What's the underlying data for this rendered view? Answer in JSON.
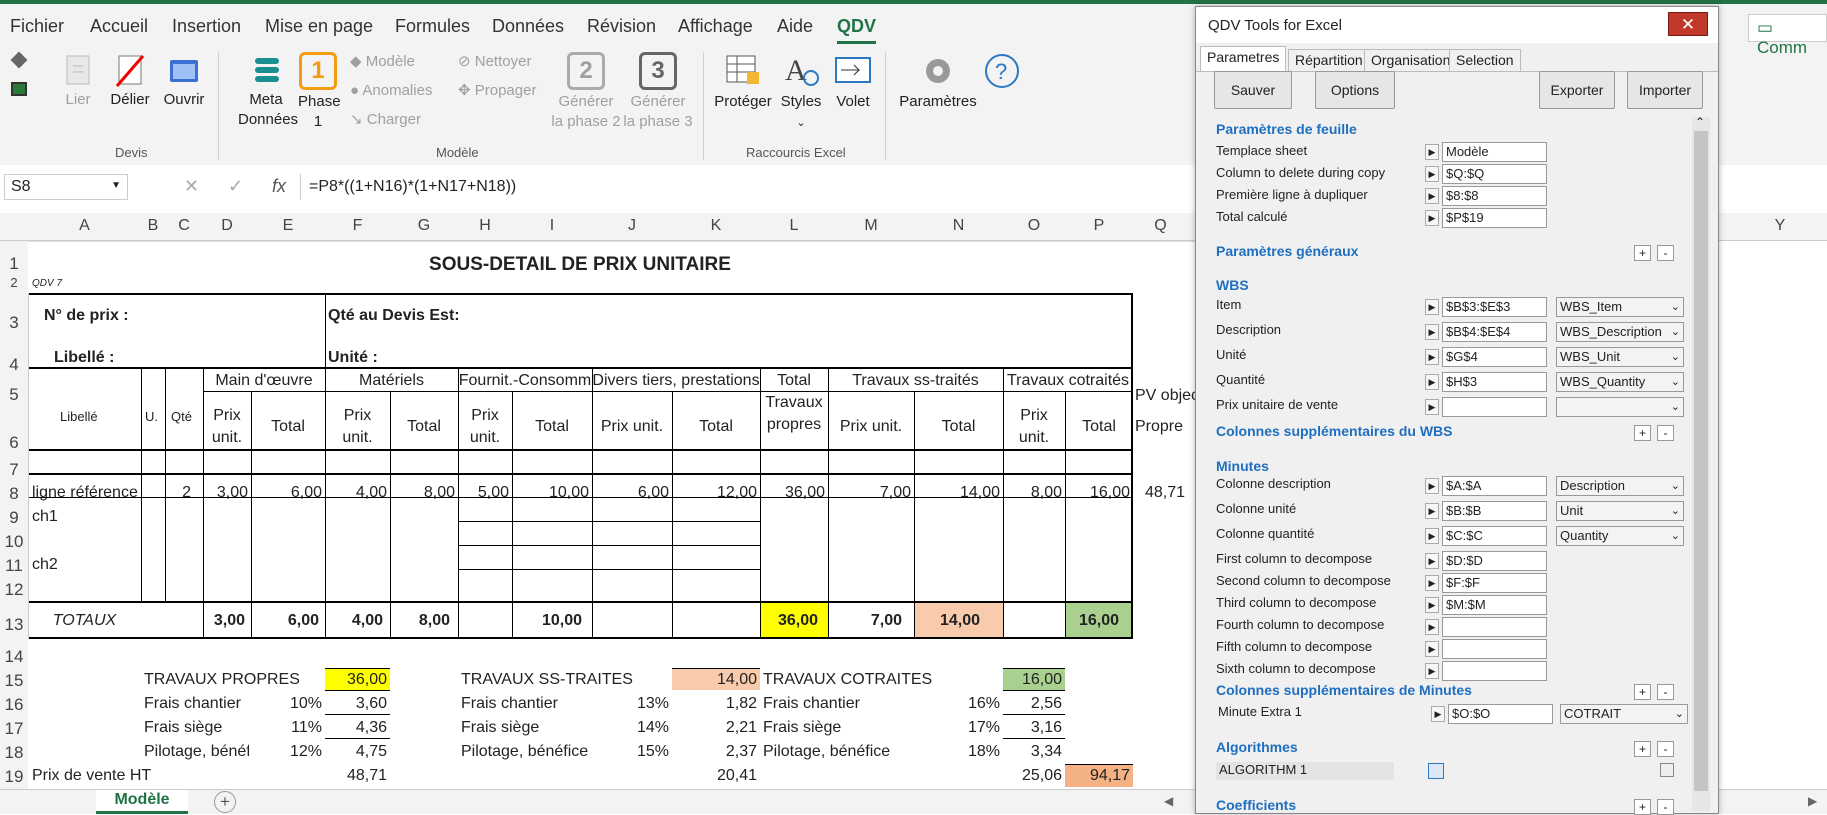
{
  "menu": [
    "Fichier",
    "Accueil",
    "Insertion",
    "Mise en page",
    "Formules",
    "Données",
    "Révision",
    "Affichage",
    "Aide",
    "QDV"
  ],
  "ribbon": {
    "devis": {
      "lier": "Lier",
      "delier": "Délier",
      "ouvrir": "Ouvrir",
      "label": "Devis"
    },
    "modele": {
      "meta1": "Meta",
      "meta2": "Données",
      "phase1a": "Phase",
      "phase1b": "1",
      "phase1_num": "1",
      "modele": "Modèle",
      "anomalies": "Anomalies",
      "charger": "Charger",
      "nettoyer": "Nettoyer",
      "propager": "Propager",
      "gen2a": "Générer",
      "gen2b": "la phase 2",
      "gen2_num": "2",
      "gen3a": "Générer",
      "gen3b": "la phase 3",
      "gen3_num": "3",
      "label": "Modèle"
    },
    "raccourcis": {
      "proteger": "Protéger",
      "styles": "Styles",
      "volet": "Volet",
      "label": "Raccourcis Excel"
    },
    "parametres": "Paramètres",
    "comm": "Comm"
  },
  "formula": {
    "namebox": "S8",
    "fx": "fx",
    "formula": "=P8*((1+N16)*(1+N17+N18))"
  },
  "columns": [
    "A",
    "B",
    "C",
    "D",
    "E",
    "F",
    "G",
    "H",
    "I",
    "J",
    "K",
    "L",
    "M",
    "N",
    "O",
    "P",
    "Q",
    "Y"
  ],
  "rows": [
    "1",
    "2",
    "3",
    "4",
    "5",
    "6",
    "7",
    "8",
    "9",
    "10",
    "11",
    "12",
    "13",
    "14",
    "15",
    "16",
    "17",
    "18",
    "19"
  ],
  "sheet": {
    "title": "SOUS-DETAIL DE PRIX UNITAIRE",
    "qdv7": "QDV 7",
    "nprix": "N° de prix :",
    "qte_devis": "Qté au Devis Est:",
    "libelle_lbl": "Libellé :",
    "unite_lbl": "Unité :",
    "h_libelle": "Libellé",
    "h_u": "U.",
    "h_qte": "Qté",
    "h_mo": "Main d'œuvre",
    "h_mat": "Matériels",
    "h_fourn": "Fournit.-Consomm",
    "h_divers": "Divers tiers, prestations",
    "h_total1": "Total",
    "h_total2": "Travaux",
    "h_total3": "propres",
    "h_sst": "Travaux ss-traités",
    "h_cot": "Travaux cotraités",
    "h_pv": "PV objec",
    "h_prix1": "Prix",
    "h_unit": "unit.",
    "h_total": "Total",
    "h_prixunit": "Prix unit.",
    "h_propre": "Propre",
    "r8": {
      "lib": "ligne référence",
      "qte": "2",
      "d": "3,00",
      "e": "6,00",
      "f": "4,00",
      "g": "8,00",
      "h": "5,00",
      "i": "10,00",
      "j": "6,00",
      "k": "12,00",
      "l": "36,00",
      "m": "7,00",
      "n": "14,00",
      "o": "8,00",
      "p": "16,00",
      "q": "48,71"
    },
    "r9": "ch1",
    "r11": "ch2",
    "r13": {
      "lbl": "TOTAUX",
      "d": "3,00",
      "e": "6,00",
      "f": "4,00",
      "g": "8,00",
      "i": "10,00",
      "l": "36,00",
      "m": "7,00",
      "n": "14,00",
      "p": "16,00"
    },
    "r15": {
      "tp": "TRAVAUX PROPRES",
      "tpv": "36,00",
      "tst": "TRAVAUX SS-TRAITES",
      "tstv": "14,00",
      "tco": "TRAVAUX COTRAITES",
      "tcov": "16,00"
    },
    "r16": {
      "a": "Frais chantier",
      "ap": "10%",
      "av": "3,60",
      "b": "Frais chantier",
      "bp": "13%",
      "bv": "1,82",
      "c": "Frais chantier",
      "cp": "16%",
      "cv": "2,56"
    },
    "r17": {
      "a": "Frais siège",
      "ap": "11%",
      "av": "4,36",
      "b": "Frais siège",
      "bp": "14%",
      "bv": "2,21",
      "c": "Frais siège",
      "cp": "17%",
      "cv": "3,16"
    },
    "r18": {
      "a": "Pilotage, bénéf",
      "ap": "12%",
      "av": "4,75",
      "b": "Pilotage, bénéfice",
      "bp": "15%",
      "bv": "2,37",
      "c": "Pilotage, bénéfice",
      "cp": "18%",
      "cv": "3,34"
    },
    "r19": {
      "lbl": "Prix de vente HT",
      "f": "48,71",
      "k": "20,41",
      "o": "25,06",
      "p": "94,17"
    }
  },
  "tabs": {
    "sheet": "Modèle",
    "add": "+"
  },
  "panel": {
    "title": "QDV Tools for Excel",
    "tabs": [
      "Parametres",
      "Répartition",
      "Organisation",
      "Selection"
    ],
    "buttons": {
      "sauver": "Sauver",
      "options": "Options",
      "exporter": "Exporter",
      "importer": "Importer"
    },
    "sec_feuille": "Paramètres de feuille",
    "feuille": [
      {
        "label": "Templace sheet",
        "value": "Modèle"
      },
      {
        "label": "Column to delete during copy",
        "value": "$Q:$Q"
      },
      {
        "label": "Première ligne à dupliquer",
        "value": "$8:$8"
      },
      {
        "label": "Total calculé",
        "value": "$P$19"
      }
    ],
    "sec_generaux": "Paramètres généraux",
    "sec_wbs": "WBS",
    "wbs": [
      {
        "label": "Item",
        "value": "$B$3:$E$3",
        "select": "WBS_Item"
      },
      {
        "label": "Description",
        "value": "$B$4:$E$4",
        "select": "WBS_Description"
      },
      {
        "label": "Unité",
        "value": "$G$4",
        "select": "WBS_Unit"
      },
      {
        "label": "Quantité",
        "value": "$H$3",
        "select": "WBS_Quantity"
      },
      {
        "label": "Prix unitaire de vente",
        "value": "",
        "select": ""
      }
    ],
    "sec_col_wbs": "Colonnes supplémentaires du WBS",
    "sec_minutes": "Minutes",
    "minutes": [
      {
        "label": "Colonne description",
        "value": "$A:$A",
        "select": "Description"
      },
      {
        "label": "Colonne unité",
        "value": "$B:$B",
        "select": "Unit"
      },
      {
        "label": "Colonne quantité",
        "value": "$C:$C",
        "select": "Quantity"
      },
      {
        "label": "First column to decompose",
        "value": "$D:$D"
      },
      {
        "label": "Second column to decompose",
        "value": "$F:$F"
      },
      {
        "label": "Third column to decompose",
        "value": "$M:$M"
      },
      {
        "label": "Fourth column to decompose",
        "value": ""
      },
      {
        "label": "Fifth column to decompose",
        "value": ""
      },
      {
        "label": "Sixth column to decompose",
        "value": ""
      }
    ],
    "sec_col_min": "Colonnes supplémentaires de Minutes",
    "extra": {
      "label": "Minute Extra 1",
      "value": "$O:$O",
      "select": "COTRAIT"
    },
    "sec_algo": "Algorithmes",
    "algo": "ALGORITHM 1",
    "sec_coef": "Coefficients"
  },
  "colors": {
    "excel_green": "#217346",
    "yellow": "#ffff00",
    "salmon": "#f8cbad",
    "green": "#a9d08e",
    "orange": "#f4b183",
    "accent": "#1f6fc1"
  }
}
